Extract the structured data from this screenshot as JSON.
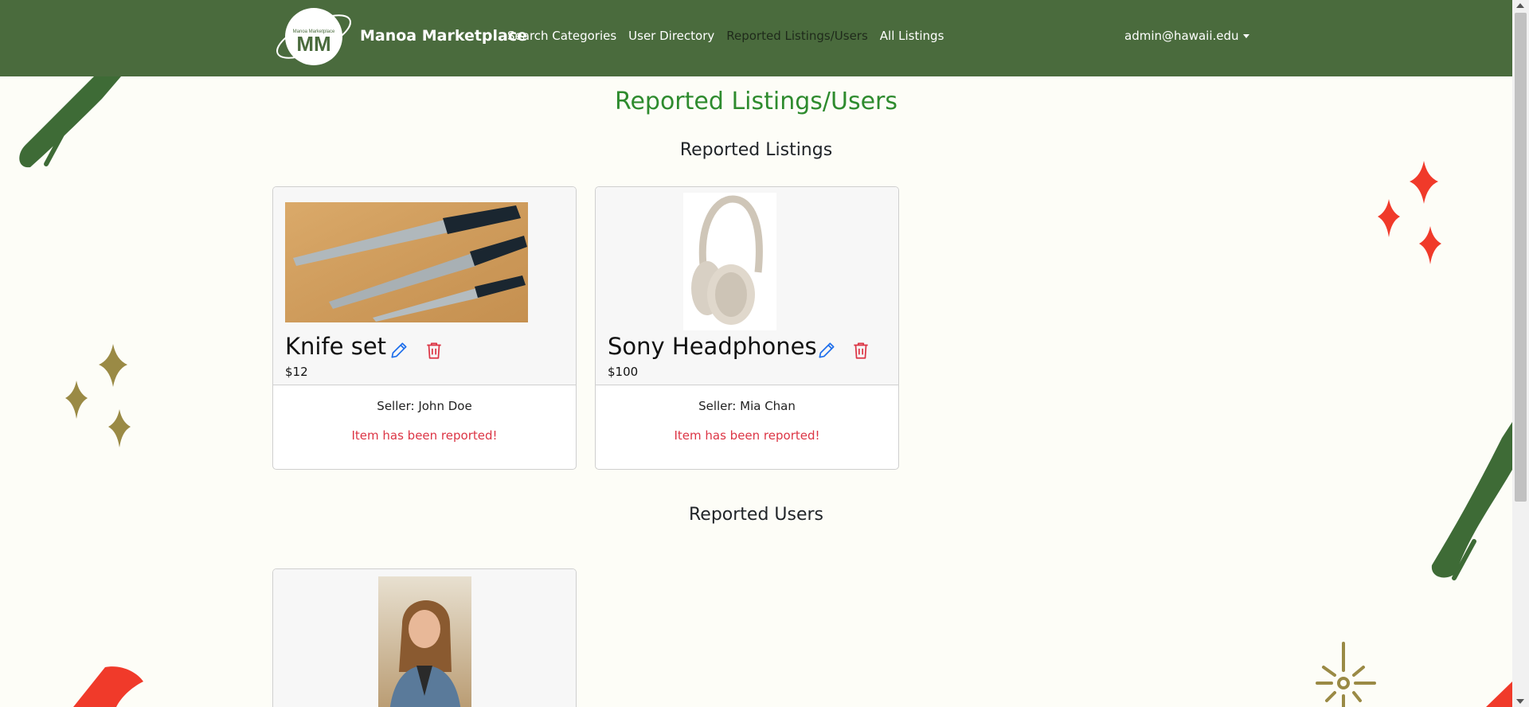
{
  "nav": {
    "brand": "Manoa Marketplace",
    "logo_text": "Manoa Marketplace",
    "links": [
      "Search Categories",
      "User Directory",
      "Reported Listings/Users",
      "All Listings"
    ],
    "user": "admin@hawaii.edu"
  },
  "page": {
    "title": "Reported Listings/Users",
    "listings_heading": "Reported Listings",
    "users_heading": "Reported Users"
  },
  "listings": [
    {
      "title": "Knife set",
      "price": "$12",
      "seller": "Seller: John Doe",
      "status": "Item has been reported!"
    },
    {
      "title": "Sony Headphones",
      "price": "$100",
      "seller": "Seller: Mia Chan",
      "status": "Item has been reported!"
    }
  ],
  "colors": {
    "navbar": "#4a6b3d",
    "page_title": "#2e8b2e",
    "reported_text": "#dc3545",
    "edit_icon": "#1f6feb",
    "delete_icon": "#dc3545",
    "decor_green": "#3e6b36",
    "decor_red": "#f03a2a",
    "decor_olive": "#9a8a45"
  }
}
